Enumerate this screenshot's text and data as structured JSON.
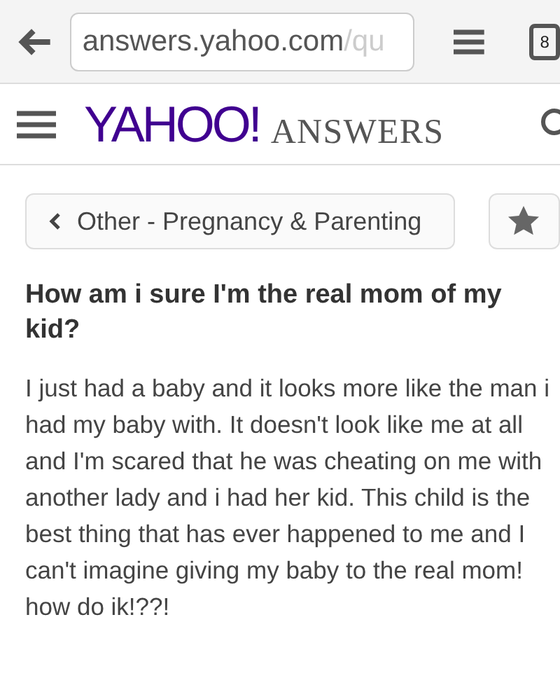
{
  "browser_bar": {
    "url_host": "answers.yahoo.com",
    "url_path": "/qu",
    "tab_count": "8"
  },
  "header": {
    "logo": "YAHOO!",
    "section": "ANSWERS"
  },
  "breadcrumb": {
    "label": "Other - Pregnancy & Parenting"
  },
  "question": {
    "title": "How am i sure I'm the real mom of my kid?",
    "body": "I just had a baby and it looks more like the man i had my baby with.  It doesn't look like me at all and I'm scared that he was cheating on me with another lady and i had her kid.  This child is the best thing that has ever happened to me and I can't imagine giving my baby to the real mom! how do ik!??!"
  }
}
